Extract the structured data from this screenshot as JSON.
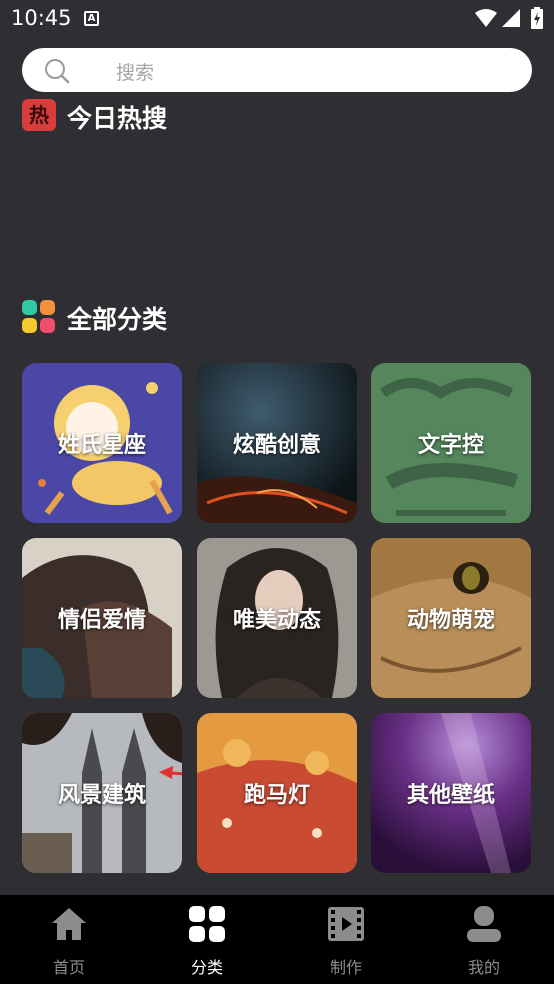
{
  "status_bar": {
    "time": "10:45"
  },
  "search": {
    "placeholder": "搜索"
  },
  "hot_section": {
    "icon_text": "热",
    "title": "今日热搜"
  },
  "all_section": {
    "title": "全部分类"
  },
  "categories": [
    {
      "label": "姓氏星座",
      "color": "#4a4aa8"
    },
    {
      "label": "炫酷创意",
      "color": "#2a3a4a"
    },
    {
      "label": "文字控",
      "color": "#4f7f5a"
    },
    {
      "label": "情侣爱情",
      "color": "#6b5a48"
    },
    {
      "label": "唯美动态",
      "color": "#8a8580"
    },
    {
      "label": "动物萌宠",
      "color": "#9a7a4a"
    },
    {
      "label": "风景建筑",
      "color": "#8a8a8a"
    },
    {
      "label": "跑马灯",
      "color": "#d47a3a"
    },
    {
      "label": "其他壁纸",
      "color": "#5a2a6a"
    }
  ],
  "bottom_nav": [
    {
      "label": "首页",
      "icon": "home-icon",
      "active": false
    },
    {
      "label": "分类",
      "icon": "grid-icon",
      "active": true
    },
    {
      "label": "制作",
      "icon": "film-icon",
      "active": false
    },
    {
      "label": "我的",
      "icon": "user-icon",
      "active": false
    }
  ]
}
